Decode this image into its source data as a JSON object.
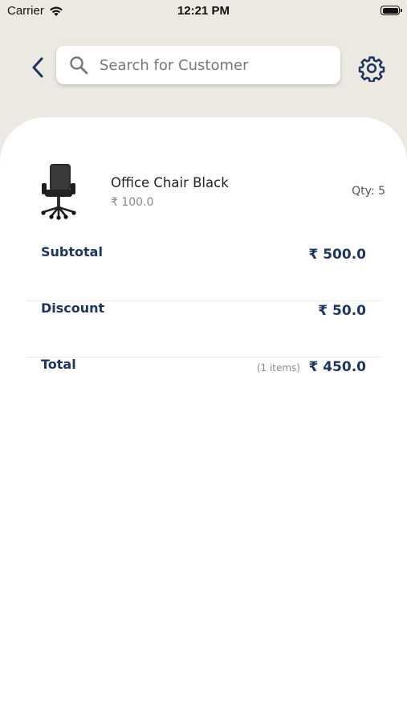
{
  "status_bar": {
    "carrier": "Carrier",
    "time": "12:21 PM"
  },
  "header": {
    "search_placeholder": "Search for Customer"
  },
  "cart": {
    "items": [
      {
        "name": "Office Chair Black",
        "price": "₹ 100.0",
        "qty_label": "Qty: 5"
      }
    ]
  },
  "summary": {
    "subtotal_label": "Subtotal",
    "subtotal_value": "₹ 500.0",
    "discount_label": "Discount",
    "discount_value": "₹ 50.0",
    "total_label": "Total",
    "items_count": "(1 items)",
    "total_value": "₹ 450.0"
  },
  "colors": {
    "accent": "#1e3563",
    "background": "#ece8e2",
    "sheet": "#ffffff"
  },
  "icons": [
    "wifi-icon",
    "battery-icon",
    "back-chevron-icon",
    "search-icon",
    "gear-icon"
  ]
}
